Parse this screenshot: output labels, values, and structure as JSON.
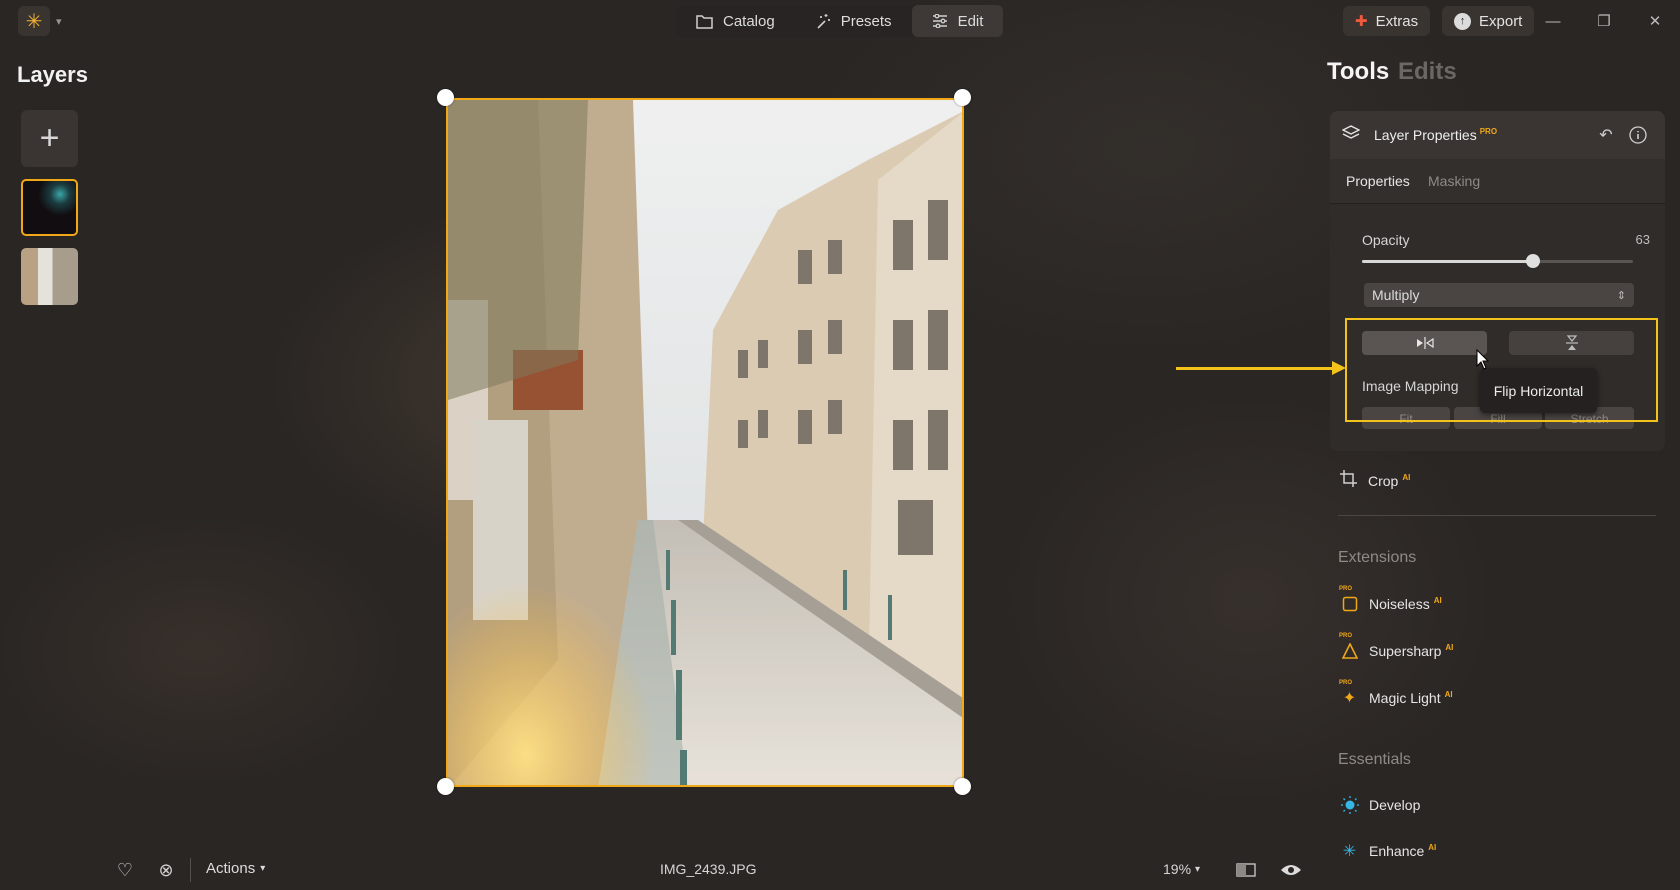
{
  "header": {
    "mode_tabs": [
      {
        "label": "Catalog",
        "icon": "folder-icon"
      },
      {
        "label": "Presets",
        "icon": "magic-wand-icon"
      },
      {
        "label": "Edit",
        "icon": "sliders-icon"
      }
    ],
    "active_mode": "Edit",
    "extras_label": "Extras",
    "export_label": "Export"
  },
  "layers": {
    "title": "Layers",
    "count": 2
  },
  "canvas": {
    "filename": "IMG_2439.JPG",
    "zoom": "19%"
  },
  "bottom_bar": {
    "actions_label": "Actions"
  },
  "right_panel": {
    "tabs": [
      "Tools",
      "Edits"
    ],
    "active_tab": "Tools",
    "layer_properties": {
      "title": "Layer Properties",
      "badge": "PRO",
      "subtabs": [
        "Properties",
        "Masking"
      ],
      "active_subtab": "Properties",
      "opacity_label": "Opacity",
      "opacity_value": "63",
      "opacity_fraction": 0.63,
      "blend_mode": "Multiply",
      "image_mapping_label": "Image Mapping",
      "mapping_options": [
        "Fit",
        "Fill",
        "Stretch"
      ],
      "tooltip": "Flip Horizontal"
    },
    "crop": {
      "label": "Crop",
      "badge": "AI"
    },
    "extensions": {
      "title": "Extensions",
      "items": [
        {
          "label": "Noiseless",
          "badge": "AI",
          "icon": "noiseless-icon",
          "pro": "PRO"
        },
        {
          "label": "Supersharp",
          "badge": "AI",
          "icon": "supersharp-icon",
          "pro": "PRO"
        },
        {
          "label": "Magic Light",
          "badge": "AI",
          "icon": "magic-light-icon",
          "pro": "PRO"
        }
      ]
    },
    "essentials": {
      "title": "Essentials",
      "items": [
        {
          "label": "Develop",
          "badge": "",
          "icon": "develop-icon"
        },
        {
          "label": "Enhance",
          "badge": "AI",
          "icon": "enhance-icon"
        }
      ]
    }
  },
  "colors": {
    "accent": "#f0a818",
    "highlight": "#f3c21b",
    "background": "#2a2624"
  }
}
